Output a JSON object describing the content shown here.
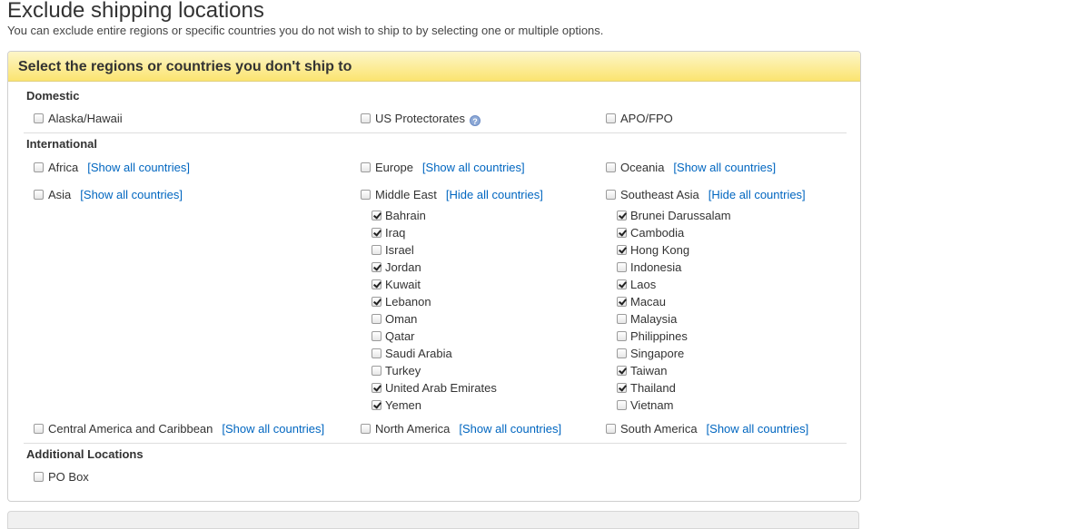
{
  "page": {
    "title": "Exclude shipping locations",
    "subtitle": "You can exclude entire regions or specific countries you do not wish to ship to by selecting one or multiple options."
  },
  "panel": {
    "header": "Select the regions or countries you don't ship to"
  },
  "domestic": {
    "title": "Domestic",
    "options": [
      {
        "label": "Alaska/Hawaii",
        "checked": false
      },
      {
        "label": "US Protectorates",
        "checked": false,
        "help_icon": "question-mark-icon"
      },
      {
        "label": "APO/FPO",
        "checked": false
      }
    ]
  },
  "international": {
    "title": "International",
    "regions": {
      "africa": {
        "label": "Africa",
        "link": "[Show all countries]",
        "checked": false
      },
      "europe": {
        "label": "Europe",
        "link": "[Show all countries]",
        "checked": false
      },
      "oceania": {
        "label": "Oceania",
        "link": "[Show all countries]",
        "checked": false
      },
      "asia": {
        "label": "Asia",
        "link": "[Show all countries]",
        "checked": false
      },
      "middle_east": {
        "label": "Middle East",
        "link": "[Hide all countries]",
        "checked": false
      },
      "southeast_asia": {
        "label": "Southeast Asia",
        "link": "[Hide all countries]",
        "checked": false
      },
      "central_america": {
        "label": "Central America and Caribbean",
        "link": "[Show all countries]",
        "checked": false
      },
      "north_america": {
        "label": "North America",
        "link": "[Show all countries]",
        "checked": false
      },
      "south_america": {
        "label": "South America",
        "link": "[Show all countries]",
        "checked": false
      }
    },
    "middle_east_countries": [
      {
        "label": "Bahrain",
        "checked": true
      },
      {
        "label": "Iraq",
        "checked": true
      },
      {
        "label": "Israel",
        "checked": false
      },
      {
        "label": "Jordan",
        "checked": true
      },
      {
        "label": "Kuwait",
        "checked": true
      },
      {
        "label": "Lebanon",
        "checked": true
      },
      {
        "label": "Oman",
        "checked": false
      },
      {
        "label": "Qatar",
        "checked": false
      },
      {
        "label": "Saudi Arabia",
        "checked": false
      },
      {
        "label": "Turkey",
        "checked": false
      },
      {
        "label": "United Arab Emirates",
        "checked": true
      },
      {
        "label": "Yemen",
        "checked": true
      }
    ],
    "southeast_asia_countries": [
      {
        "label": "Brunei Darussalam",
        "checked": true
      },
      {
        "label": "Cambodia",
        "checked": true
      },
      {
        "label": "Hong Kong",
        "checked": true
      },
      {
        "label": "Indonesia",
        "checked": false
      },
      {
        "label": "Laos",
        "checked": true
      },
      {
        "label": "Macau",
        "checked": true
      },
      {
        "label": "Malaysia",
        "checked": false
      },
      {
        "label": "Philippines",
        "checked": false
      },
      {
        "label": "Singapore",
        "checked": false
      },
      {
        "label": "Taiwan",
        "checked": true
      },
      {
        "label": "Thailand",
        "checked": true
      },
      {
        "label": "Vietnam",
        "checked": false
      }
    ]
  },
  "additional": {
    "title": "Additional Locations",
    "options": [
      {
        "label": "PO Box",
        "checked": false
      }
    ]
  },
  "colors": {
    "header_gradient_top": "#fdf6c8",
    "header_gradient_bottom": "#fbe470",
    "link": "#0066c0"
  }
}
